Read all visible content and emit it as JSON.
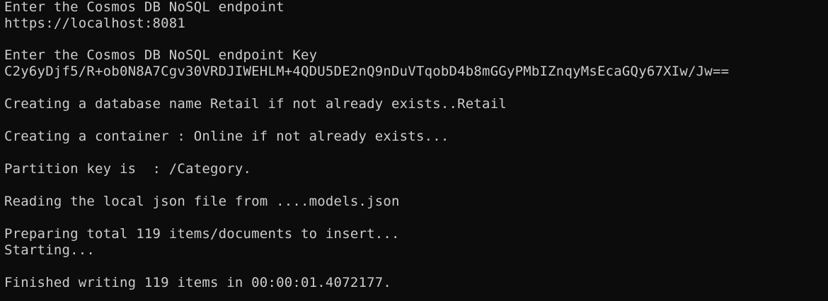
{
  "terminal": {
    "lines": [
      "Enter the Cosmos DB NoSQL endpoint",
      "https://localhost:8081",
      "Enter the Cosmos DB NoSQL endpoint Key",
      "C2y6yDjf5/R+ob0N8A7Cgv30VRDJIWEHLM+4QDU5DE2nQ9nDuVTqobD4b8mGGyPMbIZnqyMsEcaGQy67XIw/Jw==",
      "Creating a database name Retail if not already exists..Retail",
      "Creating a container : Online if not already exists...",
      "Partition key is  : /Category.",
      "Reading the local json file from ....models.json",
      "Preparing total 119 items/documents to insert...",
      "Starting...",
      "Finished writing 119 items in 00:00:01.4072177."
    ]
  },
  "colors": {
    "background": "#0c0c0c",
    "text": "#cccccc"
  }
}
